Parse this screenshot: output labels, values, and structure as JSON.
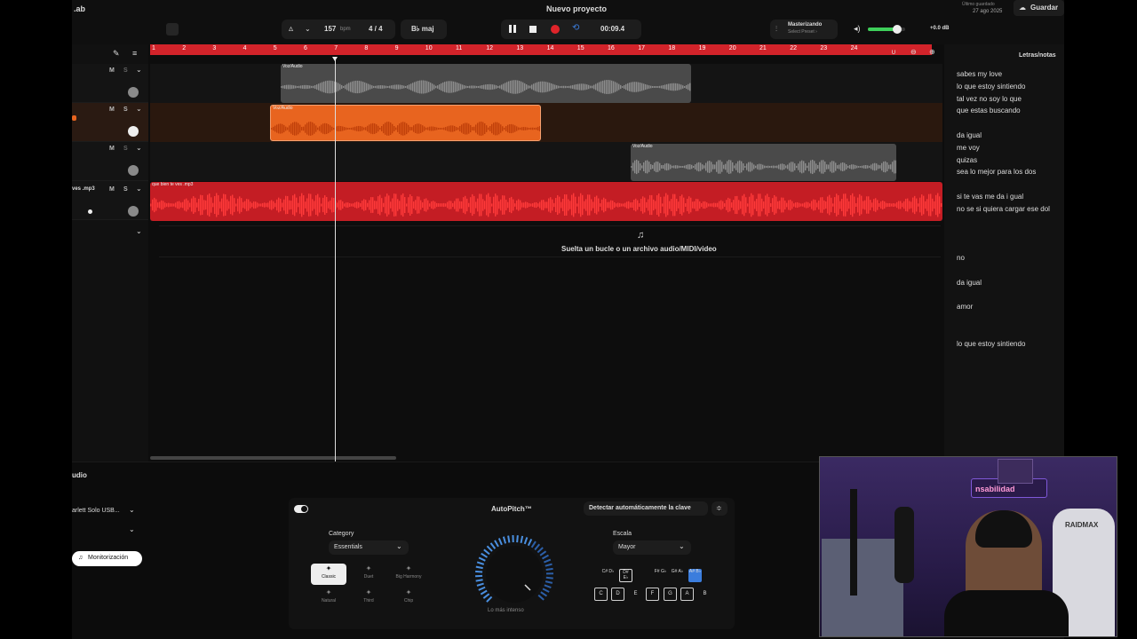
{
  "header": {
    "brand_fragment": ".ab",
    "project_title": "Nuevo proyecto",
    "tempo": "157",
    "tempo_unit": "bpm",
    "time_signature": "4 / 4",
    "key": "B♭ maj",
    "time": "00:09.4",
    "mastering_title": "Masterizando",
    "mastering_sub": "Select Preset ›",
    "volume_db": "+0.0 dB",
    "saved_label": "Último guardado",
    "saved_date": "27 ago 2025",
    "save_button": "Guardar"
  },
  "ruler": {
    "bars": [
      "1",
      "2",
      "3",
      "4",
      "5",
      "6",
      "7",
      "8",
      "9",
      "10",
      "11",
      "12",
      "13",
      "14",
      "15",
      "16",
      "17",
      "18",
      "19",
      "20",
      "21",
      "22",
      "23",
      "24"
    ]
  },
  "tracks": [
    {
      "name": "",
      "mute": "M",
      "solo": "S",
      "clip_label": "Voz/Audio",
      "color": "#8a8a8a"
    },
    {
      "name": "",
      "mute": "M",
      "solo": "S",
      "clip_label": "Voz/Audio",
      "color": "#e8641f"
    },
    {
      "name": "",
      "mute": "M",
      "solo": "S",
      "clip_label": "Voz/Audio",
      "color": "#8a8a8a"
    },
    {
      "name": "ves .mp3",
      "mute": "M",
      "solo": "S",
      "clip_label": "que bien te ves .mp3",
      "color": "#e0242a"
    }
  ],
  "drop_zone": {
    "text": "Suelta un bucle o un archivo audio/MIDI/video"
  },
  "lyrics": {
    "title": "Letras/notas",
    "lines": [
      "sabes my love",
      "lo que estoy  sintiendo",
      "tal vez no soy lo que",
      "que estas buscando",
      "",
      "da igual",
      "me voy",
      "quizas",
      "sea lo mejor para los dos",
      "",
      "si te vas me da i gual",
      "no se si quiera cargar ese dol",
      "",
      "",
      "",
      "no",
      "",
      "da igual",
      "",
      "amor",
      "",
      "",
      "lo que estoy sintiendo"
    ]
  },
  "bottom": {
    "section_title": "udio",
    "input_device": "arlett Solo USB...",
    "monitor_button": "Monitorización",
    "plugin": {
      "title": "AutoPitch™",
      "detect_button": "Detectar automáticamente la clave",
      "category_label": "Category",
      "category_value": "Essentials",
      "presets": [
        "Classic",
        "Duet",
        "Big Harmony",
        "Natural",
        "Third",
        "Chip"
      ],
      "knob_label": "Lo más intenso",
      "scale_label": "Escala",
      "scale_value": "Mayor",
      "black_keys": [
        "C#\nD♭",
        "D#\nE♭",
        "F#\nG♭",
        "G#\nA♭",
        "A#\nB♭"
      ],
      "white_keys": [
        "C",
        "D",
        "E",
        "F",
        "G",
        "A",
        "B"
      ]
    }
  },
  "webcam": {
    "sign_text": "nsabilidad",
    "chair_brand": "RAIDMAX"
  },
  "colors": {
    "accent": "#e8641f",
    "ruler": "#d2232a",
    "record": "#e0242a",
    "loop": "#3b7ddd",
    "meter": "#3ecf5a"
  }
}
